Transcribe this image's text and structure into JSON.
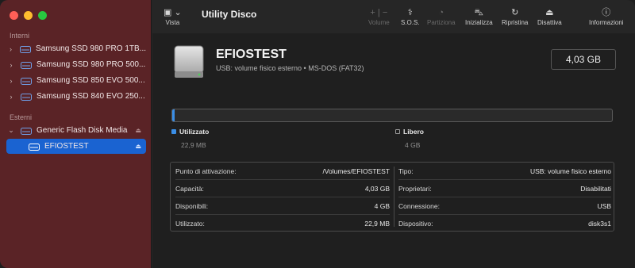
{
  "app": {
    "title": "Utility Disco"
  },
  "toolbar": {
    "view_label": "Vista",
    "volume_label": "Volume",
    "firstaid_label": "S.O.S.",
    "partition_label": "Partiziona",
    "erase_label": "Inizializza",
    "restore_label": "Ripristina",
    "unmount_label": "Disattiva",
    "info_label": "Informazioni"
  },
  "sidebar": {
    "internal_header": "Interni",
    "external_header": "Esterni",
    "internal_items": [
      {
        "label": "Samsung SSD 980 PRO 1TB..."
      },
      {
        "label": "Samsung SSD 980 PRO 500..."
      },
      {
        "label": "Samsung SSD 850 EVO 500..."
      },
      {
        "label": "Samsung SSD 840 EVO 250..."
      }
    ],
    "external_items": [
      {
        "label": "Generic Flash Disk Media"
      },
      {
        "label": "EFIOSTEST"
      }
    ]
  },
  "volume": {
    "name": "EFIOSTEST",
    "subtitle": "USB: volume fisico esterno • MS-DOS (FAT32)",
    "size": "4,03 GB",
    "used_fraction": 0.0057
  },
  "legend": {
    "used_label": "Utilizzato",
    "used_value": "22,9 MB",
    "free_label": "Libero",
    "free_value": "4 GB"
  },
  "info": {
    "left": [
      {
        "key": "Punto di attivazione:",
        "value": "/Volumes/EFIOSTEST"
      },
      {
        "key": "Capacità:",
        "value": "4,03 GB"
      },
      {
        "key": "Disponibili:",
        "value": "4 GB"
      },
      {
        "key": "Utilizzato:",
        "value": "22,9 MB"
      }
    ],
    "right": [
      {
        "key": "Tipo:",
        "value": "USB: volume fisico esterno"
      },
      {
        "key": "Proprietari:",
        "value": "Disabilitati"
      },
      {
        "key": "Connessione:",
        "value": "USB"
      },
      {
        "key": "Dispositivo:",
        "value": "disk3s1"
      }
    ]
  },
  "colors": {
    "sidebar_bg": "#5a2326",
    "selection": "#1a63d1",
    "used": "#3a8ee6"
  }
}
